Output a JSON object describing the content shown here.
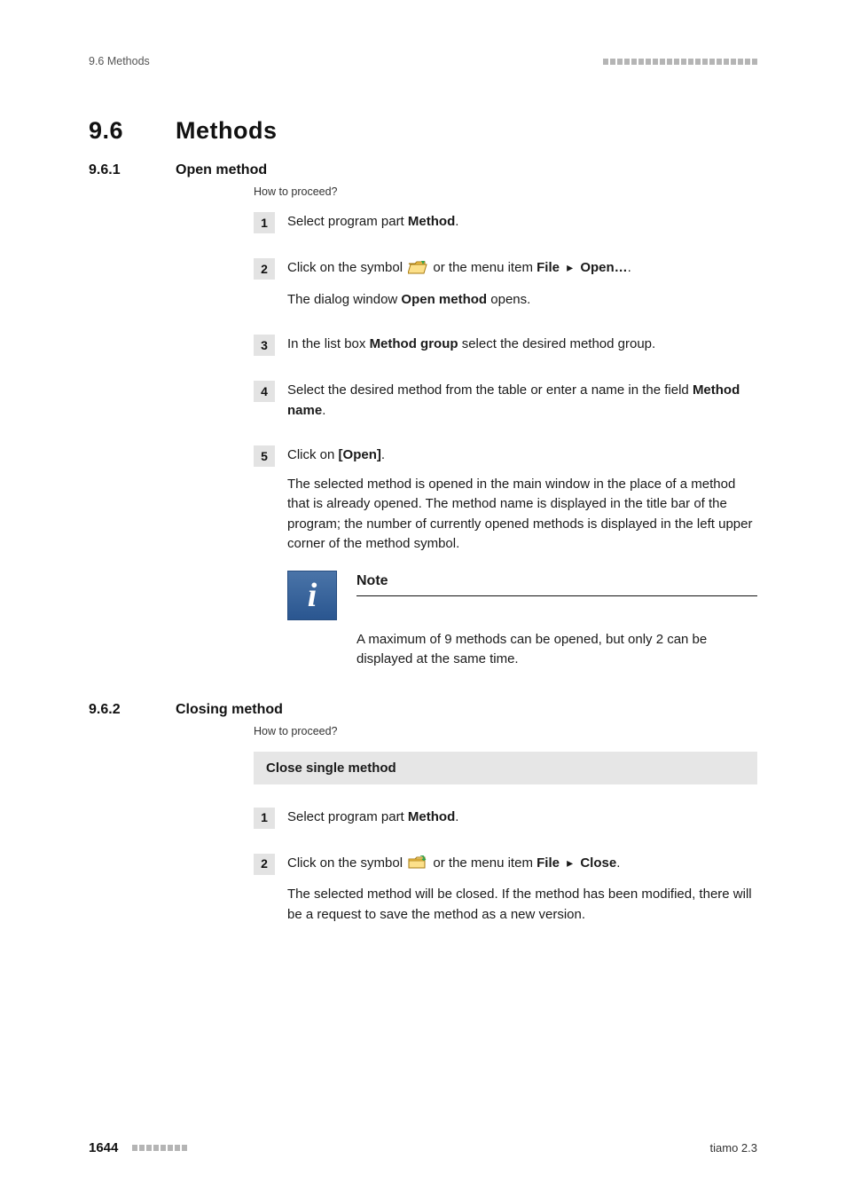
{
  "header": {
    "breadcrumb": "9.6 Methods"
  },
  "h1": {
    "num": "9.6",
    "title": "Methods"
  },
  "sec1": {
    "num": "9.6.1",
    "title": "Open method",
    "howto": "How to proceed?",
    "steps": {
      "s1": {
        "n": "1",
        "a": "Select program part ",
        "b": "Method",
        "c": "."
      },
      "s2": {
        "n": "2",
        "a1": "Click on the symbol ",
        "a2": " or the menu item ",
        "menu1": "File",
        "menu2": "Open…",
        "a3": ".",
        "p2a": "The dialog window ",
        "p2b": "Open method",
        "p2c": " opens."
      },
      "s3": {
        "n": "3",
        "a": "In the list box ",
        "b": "Method group",
        "c": " select the desired method group."
      },
      "s4": {
        "n": "4",
        "a": "Select the desired method from the table or enter a name in the field ",
        "b": "Method name",
        "c": "."
      },
      "s5": {
        "n": "5",
        "a": "Click on ",
        "b": "[Open]",
        "c": ".",
        "p2": "The selected method is opened in the main window in the place of a method that is already opened. The method name is displayed in the title bar of the program; the number of currently opened methods is displayed in the left upper corner of the method symbol."
      }
    },
    "note": {
      "title": "Note",
      "body": "A maximum of 9 methods can be opened, but only 2 can be displayed at the same time."
    }
  },
  "sec2": {
    "num": "9.6.2",
    "title": "Closing method",
    "howto": "How to proceed?",
    "subhead": "Close single method",
    "steps": {
      "s1": {
        "n": "1",
        "a": "Select program part ",
        "b": "Method",
        "c": "."
      },
      "s2": {
        "n": "2",
        "a1": "Click on the symbol ",
        "a2": " or the menu item ",
        "menu1": "File",
        "menu2": "Close",
        "a3": ".",
        "p2": "The selected method will be closed. If the method has been modified, there will be a request to save the method as a new version."
      }
    }
  },
  "footer": {
    "page": "1644",
    "product": "tiamo 2.3"
  }
}
